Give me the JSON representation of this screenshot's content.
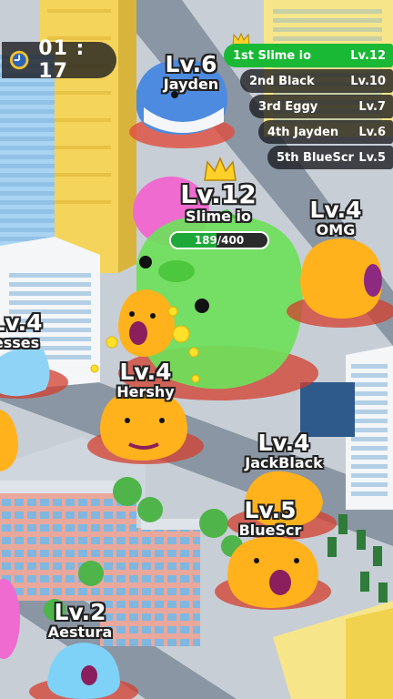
{
  "timer": {
    "value": "01 : 17",
    "icon": "clock-icon"
  },
  "leaderboard": [
    {
      "rank_name": "1st  Slime io",
      "level": "Lv.12",
      "color": "#19b935"
    },
    {
      "rank_name": "2nd  Black",
      "level": "Lv.10"
    },
    {
      "rank_name": "3rd  Eggy",
      "level": "Lv.7"
    },
    {
      "rank_name": "4th  Jayden",
      "level": "Lv.6"
    },
    {
      "rank_name": "5th  BlueScr",
      "level": "Lv.5"
    }
  ],
  "player": {
    "level": "Lv.12",
    "name": "Slime io",
    "xp_text": "189/400",
    "xp_fraction": 0.4725
  },
  "slimes": [
    {
      "level": "Lv.6",
      "name": "Jayden"
    },
    {
      "level": "Lv.4",
      "name": "OMG"
    },
    {
      "level": "Lv.4",
      "name": "esses"
    },
    {
      "level": "Lv.4",
      "name": "Hershy"
    },
    {
      "level": "Lv.4",
      "name": "JackBlack"
    },
    {
      "level": "Lv.5",
      "name": "BlueScr"
    },
    {
      "level": "Lv.2",
      "name": "Aestura"
    }
  ],
  "colors": {
    "player_slime": "#6ee05a",
    "enemy_slime": "#ffb21c",
    "road": "#8a96a3",
    "ground": "#c7ced6"
  }
}
